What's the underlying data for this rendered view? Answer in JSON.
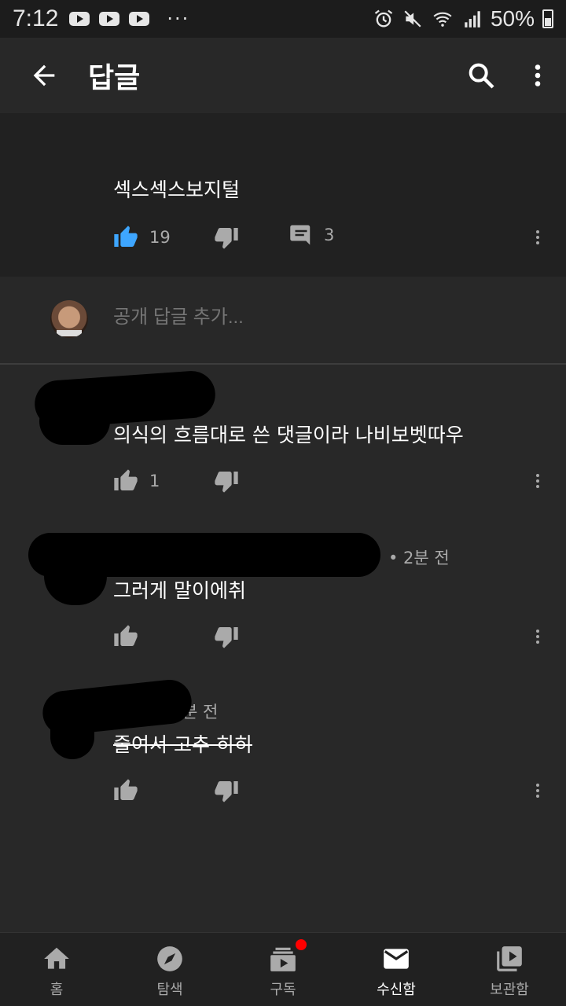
{
  "status_bar": {
    "time": "7:12",
    "more": "···",
    "battery": "50%"
  },
  "header": {
    "title": "답글"
  },
  "main_comment": {
    "text": "섹스섹스보지털",
    "likes": "19",
    "replies": "3"
  },
  "add_reply": {
    "placeholder": "공개 답글 추가..."
  },
  "replies": [
    {
      "meta": "",
      "text": "의식의 흐름대로 쓴 댓글이라 나비보벳따우",
      "likes": "1"
    },
    {
      "meta": "• 2분 전",
      "text": "그러게 말이에취",
      "likes": ""
    },
    {
      "meta": "분 전",
      "text": "줄여서 고추 히히",
      "likes": "",
      "strikethrough": true
    }
  ],
  "bottom_nav": {
    "items": [
      {
        "label": "홈",
        "icon": "home-icon"
      },
      {
        "label": "탐색",
        "icon": "explore-icon"
      },
      {
        "label": "구독",
        "icon": "subscriptions-icon"
      },
      {
        "label": "수신함",
        "icon": "inbox-icon"
      },
      {
        "label": "보관함",
        "icon": "library-icon"
      }
    ],
    "active": "수신함"
  },
  "colors": {
    "like_active": "#3ea6ff",
    "background": "#282828",
    "highlight_comment_bg": "#212121",
    "notification": "#ff0000"
  }
}
